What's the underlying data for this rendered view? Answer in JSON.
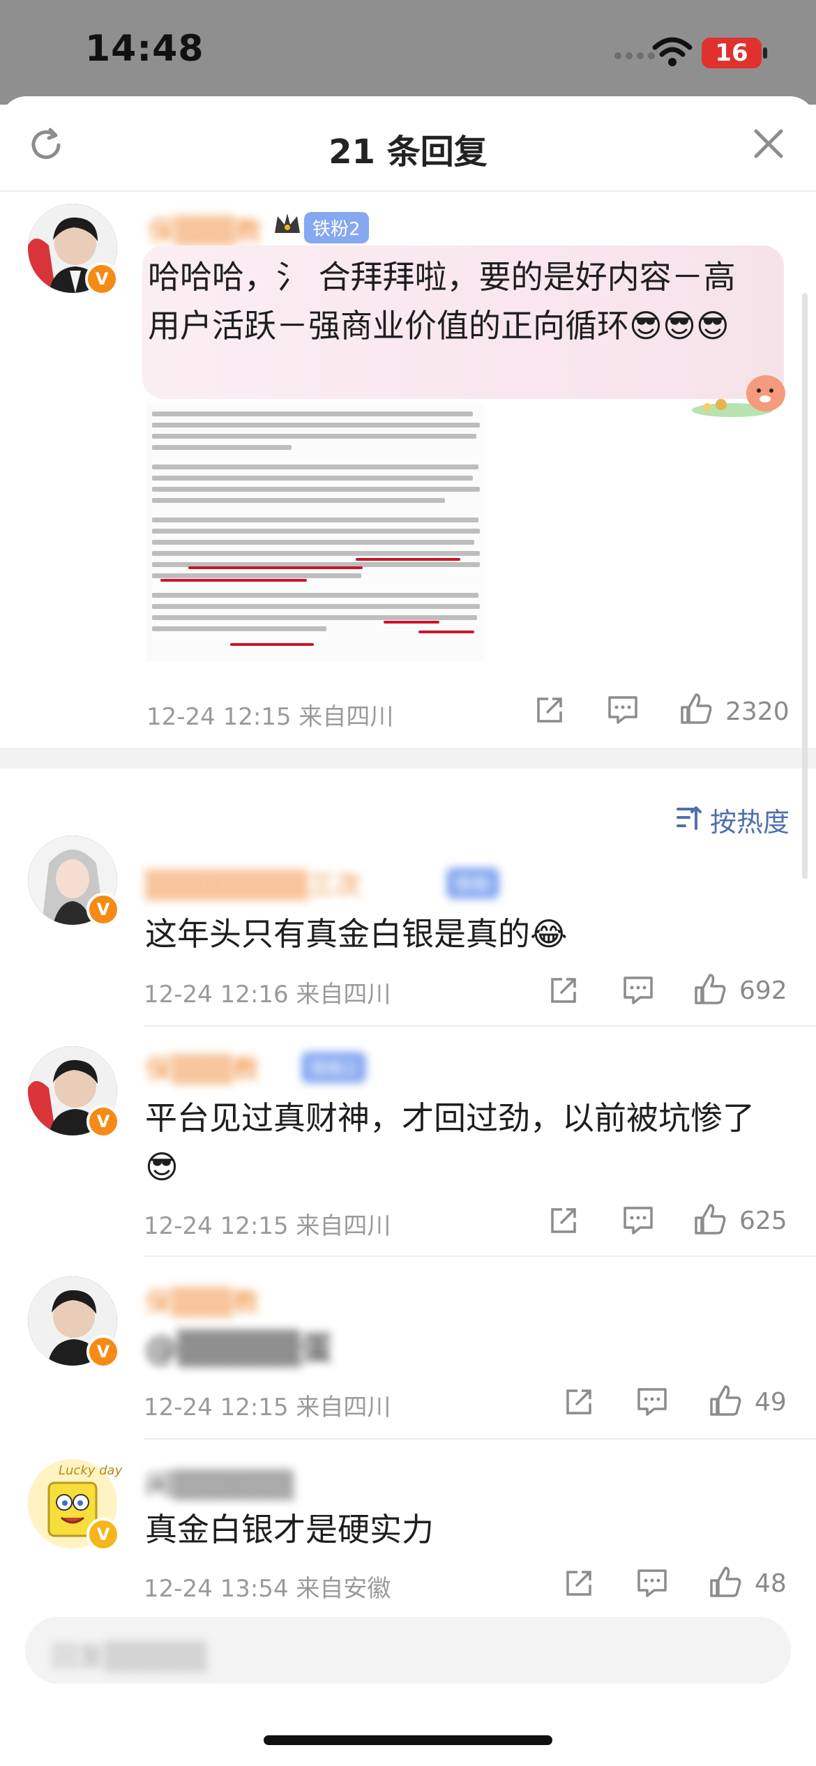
{
  "status_bar": {
    "time": "14:48",
    "battery": "16"
  },
  "sheet": {
    "title": "21 条回复"
  },
  "top_comment": {
    "username": "保▒▒▒教",
    "fan_badge": "铁粉2",
    "text": "哈哈哈，氵 合拜拜啦，要的是好内容－高用户活跃－强商业价值的正向循环😎😎😎",
    "meta": "12-24 12:15 来自四川",
    "likes": "2320"
  },
  "sort": {
    "label": "按热度"
  },
  "comments": [
    {
      "username": "▒▒▒▒▒▒▒▒三次",
      "fan_badge": "铁粉",
      "text": "这年头只有真金白银是真的😂",
      "meta": "12-24 12:16 来自四川",
      "likes": "692"
    },
    {
      "username": "保▒▒▒教",
      "fan_badge": "铁粉2",
      "text": "平台见过真财神，才回过劲，以前被坑惨了😎",
      "meta": "12-24 12:15 来自四川",
      "likes": "625"
    },
    {
      "username": "保▒▒▒教",
      "fan_badge": "",
      "text": "@▒▒▒▒▒蛋",
      "meta": "12-24 12:15 来自四川",
      "likes": "49"
    },
    {
      "username": "闲▒▒▒▒▒▒",
      "fan_badge": "",
      "text": "真金白银才是硬实力",
      "meta": "12-24 13:54 来自安徽",
      "likes": "48"
    }
  ],
  "reply_box": {
    "placeholder": "回复▒▒▒▒▒"
  },
  "avatar_text": {
    "lucky": "Lucky day"
  }
}
